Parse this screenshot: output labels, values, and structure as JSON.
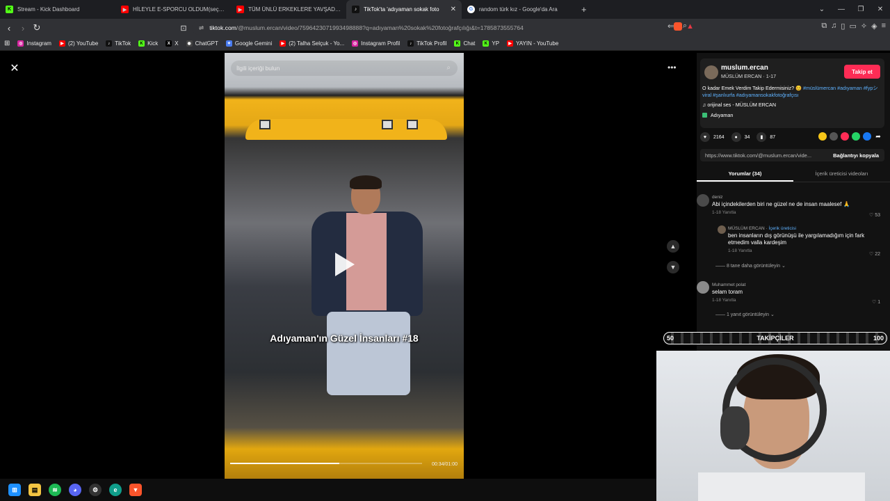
{
  "tabs": [
    {
      "title": "Stream - Kick Dashboard",
      "icon": "kick-icon",
      "color": "#53fc18"
    },
    {
      "title": "HİLEYLE E-SPORCU OLDUM(seçmel",
      "icon": "youtube-icon",
      "color": "#ff0000"
    },
    {
      "title": "TÜM ÜNLÜ ERKEKLERE YAVŞADIM. (",
      "icon": "youtube-icon",
      "color": "#ff0000"
    },
    {
      "title": "TikTok'ta 'adıyaman sokak foto",
      "icon": "tiktok-icon",
      "color": "#000000",
      "active": true
    },
    {
      "title": "random türk kız - Google'da Ara",
      "icon": "google-icon",
      "color": "#ffffff"
    }
  ],
  "address": {
    "prefix": "tiktok.com",
    "rest": "/@muslum.ercan/video/7596423071993498888?q=adıyaman%20sokak%20fotoğrafçılığı&t=1785873555764"
  },
  "bookmarks": [
    {
      "label": "Instagram",
      "color": "#d6249f"
    },
    {
      "label": "(2) YouTube",
      "color": "#ff0000"
    },
    {
      "label": "TikTok",
      "color": "#111111"
    },
    {
      "label": "Kick",
      "color": "#53fc18"
    },
    {
      "label": "X",
      "color": "#000000"
    },
    {
      "label": "ChatGPT",
      "color": "#444444"
    },
    {
      "label": "Google Gemini",
      "color": "#4a7cf0"
    },
    {
      "label": "(2) Talha Selçuk - Yo...",
      "color": "#ff0000"
    },
    {
      "label": "Instagram Profil",
      "color": "#d6249f"
    },
    {
      "label": "TikTok Profil",
      "color": "#111111"
    },
    {
      "label": "Chat",
      "color": "#53fc18"
    },
    {
      "label": "YP",
      "color": "#53fc18"
    },
    {
      "label": "YAYIN - YouTube",
      "color": "#ff0000"
    }
  ],
  "video": {
    "search_placeholder": "İlgili içeriği bulun",
    "caption": "Adıyaman'ın Güzel İnsanları #18",
    "time": "00:34/01:00",
    "progress": 0.57
  },
  "post": {
    "username": "muslum.ercan",
    "subline": "MÜSLÜM ERCAN · 1-17",
    "follow": "Takip et",
    "text": "O kadar Emek Verdim Takip Edermisiniz? 😊",
    "tags": "#müslümercan #adıyaman #fypシviral #şanlıurfa #adıyamansokakfotoğrafçısı",
    "music": "♫ orijinal ses - MÜSLÜM ERCAN",
    "location": "Adıyaman",
    "likes": "2164",
    "comments": "34",
    "saves": "87",
    "link": "https://www.tiktok.com/@muslum.ercan/vide...",
    "copy": "Bağlantıyı kopyala",
    "tab_comments": "Yorumlar (34)",
    "tab_videos": "İçerik üreticisi videoları"
  },
  "comments": [
    {
      "author": "deniz",
      "text": "Abi içindekilerden biri ne güzel ne de insan maalesef 🙏",
      "meta": "1-18    Yanıtla",
      "likes": "♡ 53"
    },
    {
      "author": "MÜSLÜM ERCAN · ",
      "badge": "İçerik üreticisi",
      "text": "ben insanların dış görünüşü ile yargılamadığım için fark etmedim valla kardeşim",
      "meta": "1-18    Yanıtla",
      "likes": "♡ 22"
    },
    {
      "author": "Muhammet polat",
      "text": "selam toram",
      "meta": "1-18    Yanıtla",
      "likes": "♡ 1"
    }
  ],
  "view_more_1": "—— 8 tane daha görüntüleyin ⌄",
  "view_more_2": "—— 1 yanıt görüntüleyin ⌄",
  "follower_bar": {
    "left": "50",
    "label": "TAKİPÇİLER",
    "right": "100"
  }
}
